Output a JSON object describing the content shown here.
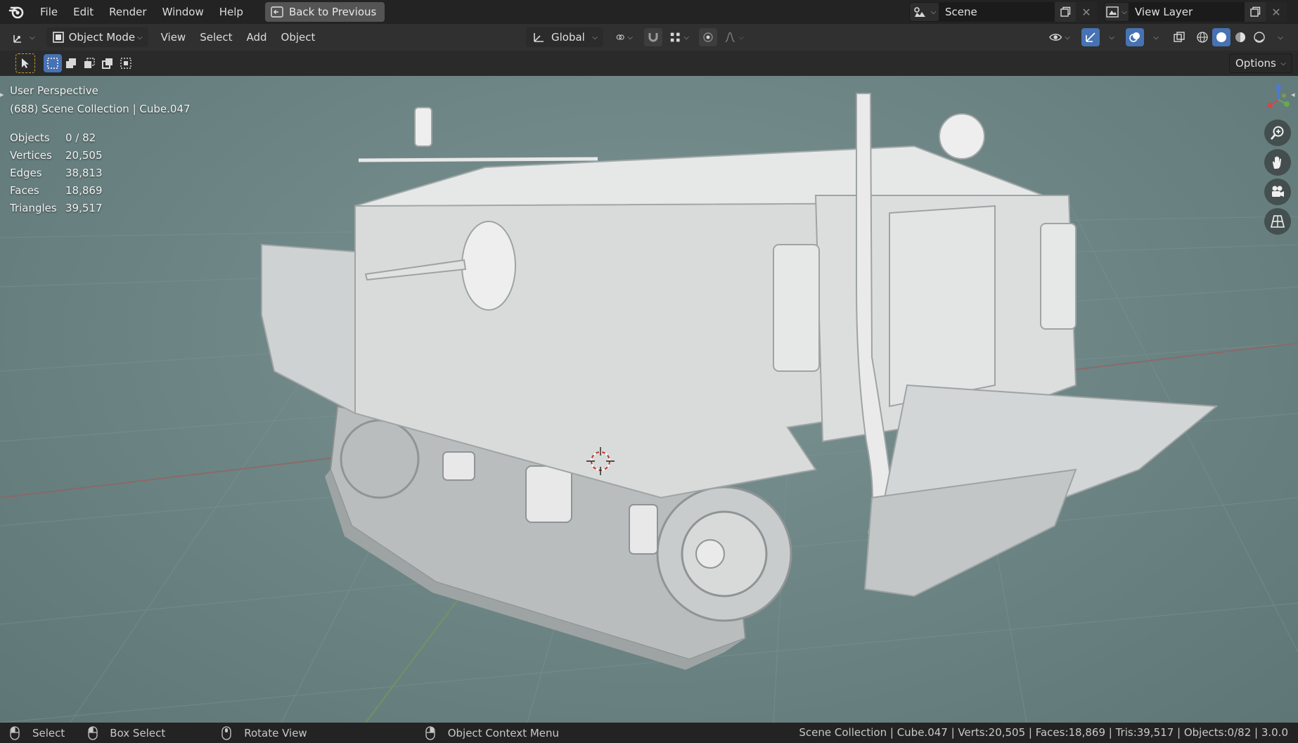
{
  "top_menu": {
    "items": [
      "File",
      "Edit",
      "Render",
      "Window",
      "Help"
    ],
    "back_button": "Back to Previous",
    "scene_label": "Scene",
    "view_layer_label": "View Layer"
  },
  "header": {
    "mode": "Object Mode",
    "menus": [
      "View",
      "Select",
      "Add",
      "Object"
    ],
    "transform_orientation": "Global"
  },
  "tool_settings": {
    "options_label": "Options"
  },
  "viewport": {
    "perspective": "User Perspective",
    "collection_info": "(688) Scene Collection | Cube.047",
    "stats": [
      {
        "label": "Objects",
        "value": "0 / 82"
      },
      {
        "label": "Vertices",
        "value": "20,505"
      },
      {
        "label": "Edges",
        "value": "38,813"
      },
      {
        "label": "Faces",
        "value": "18,869"
      },
      {
        "label": "Triangles",
        "value": "39,517"
      }
    ]
  },
  "statusbar": {
    "select": "Select",
    "box_select": "Box Select",
    "rotate_view": "Rotate View",
    "context_menu": "Object Context Menu",
    "summary": "Scene Collection | Cube.047 | Verts:20,505 | Faces:18,869 | Tris:39,517 | Objects:0/82 | 3.0.0"
  },
  "colors": {
    "viewport_bg": "#6e8686",
    "header_bg": "#303030",
    "topbar_bg": "#232323",
    "accent_blue": "#4772b3"
  }
}
